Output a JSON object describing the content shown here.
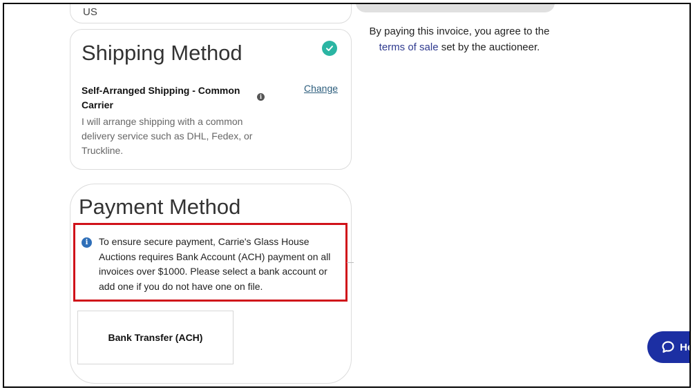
{
  "top_card": {
    "clipped_text": "US"
  },
  "shipping": {
    "title": "Shipping Method",
    "option_name": "Self-Arranged Shipping - Common Carrier",
    "change_label": "Change",
    "description": "I will arrange shipping with a common delivery service such as DHL, Fedex, or Truckline.",
    "check_icon": "check-circle-icon",
    "info_icon": "info-icon"
  },
  "payment": {
    "title": "Payment Method",
    "notice": "To ensure secure payment, Carrie's Glass House Auctions requires Bank Account (ACH) payment on all invoices over $1000. Please select a bank account or add one if you do not have one on file.",
    "notice_icon": "info-circle-icon",
    "option_label": "Bank Transfer (ACH)"
  },
  "terms": {
    "prefix": "By paying this invoice, you agree to the",
    "link": "terms of sale",
    "suffix": "set by the auctioneer."
  },
  "help": {
    "label": "He",
    "icon": "chat-bubble-icon"
  },
  "colors": {
    "check": "#2bb5a3",
    "link": "#2c5d7c",
    "terms_link": "#2f3a8f",
    "notice_border": "#d0121a",
    "info_blue": "#2f6fb8",
    "help_button": "#1c2fa3"
  }
}
